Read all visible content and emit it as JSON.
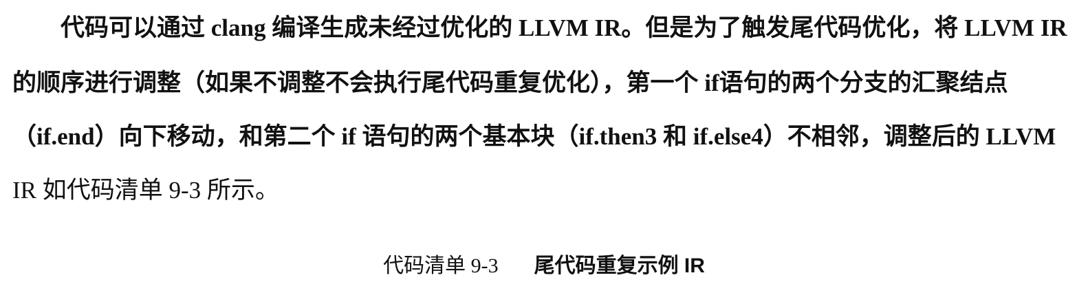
{
  "paragraph": {
    "line1": "代码可以通过 clang 编译生成未经过优化的 LLVM IR。但是为了触发尾代码优化，将 LLVM IR",
    "line2": "的顺序进行调整（如果不调整不会执行尾代码重复优化），第一个 if语句的两个分支的汇聚结点",
    "line3": "（if.end）向下移动，和第二个 if 语句的两个基本块（if.then3 和 if.else4）不相邻，调整后的 LLVM",
    "line4": "IR 如代码清单 9-3 所示。"
  },
  "caption": {
    "label": "代码清单 9-3",
    "title": "尾代码重复示例 IR"
  }
}
